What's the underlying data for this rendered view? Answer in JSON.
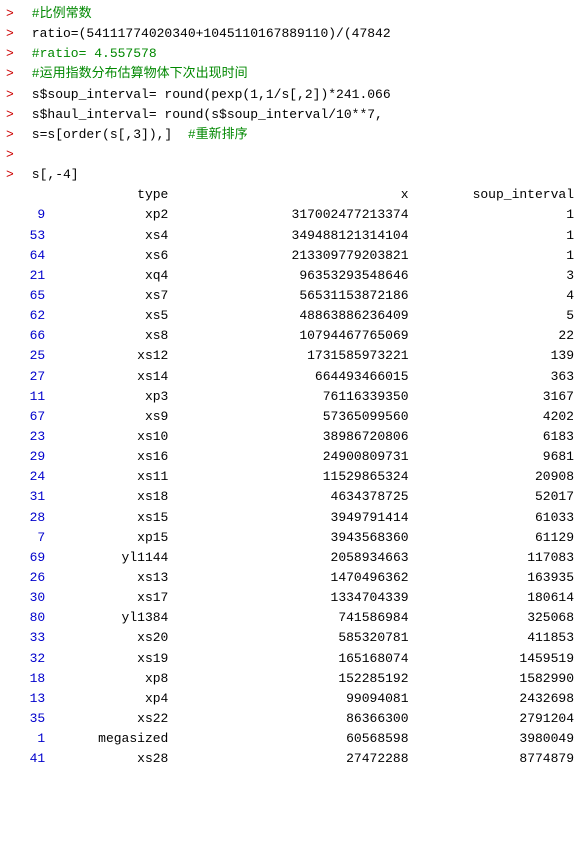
{
  "console": {
    "lines": [
      {
        "id": "line1",
        "prompt": ">",
        "type": "comment",
        "text": " #比例常数"
      },
      {
        "id": "line2",
        "prompt": ">",
        "type": "code",
        "text": " ratio=(54111774020340+1045110167889110)/(47842"
      },
      {
        "id": "line3",
        "prompt": ">",
        "type": "comment",
        "text": " #ratio= 4.557578"
      },
      {
        "id": "line4",
        "prompt": ">",
        "type": "comment",
        "text": " #运用指数分布估算物体下次出现时间"
      },
      {
        "id": "line5",
        "prompt": ">",
        "type": "code",
        "text": " s$soup_interval= round(pexp(1,1/s[,2])*241.066"
      },
      {
        "id": "line6",
        "prompt": ">",
        "type": "code",
        "text": " s$haul_interval= round(s$soup_interval/10**7,"
      },
      {
        "id": "line7",
        "prompt": ">",
        "type": "code",
        "text": " s=s[order(s[,3]),]  #重新排序"
      },
      {
        "id": "line8",
        "prompt": ">",
        "type": "blank",
        "text": ""
      },
      {
        "id": "line9",
        "prompt": ">",
        "type": "code",
        "text": " s[,-4]"
      }
    ],
    "table": {
      "headers": {
        "rownum": "",
        "type": "type",
        "x": "x",
        "soup_interval": "soup_interval"
      },
      "rows": [
        {
          "rownum": "9",
          "type": "xp2",
          "x": "317002477213374",
          "soup": "1"
        },
        {
          "rownum": "53",
          "type": "xs4",
          "x": "349488121314104",
          "soup": "1"
        },
        {
          "rownum": "64",
          "type": "xs6",
          "x": "213309779203821",
          "soup": "1"
        },
        {
          "rownum": "21",
          "type": "xq4",
          "x": "96353293548646",
          "soup": "3"
        },
        {
          "rownum": "65",
          "type": "xs7",
          "x": "56531153872186",
          "soup": "4"
        },
        {
          "rownum": "62",
          "type": "xs5",
          "x": "48863886236409",
          "soup": "5"
        },
        {
          "rownum": "66",
          "type": "xs8",
          "x": "10794467765069",
          "soup": "22"
        },
        {
          "rownum": "25",
          "type": "xs12",
          "x": "1731585973221",
          "soup": "139"
        },
        {
          "rownum": "27",
          "type": "xs14",
          "x": "664493466015",
          "soup": "363"
        },
        {
          "rownum": "11",
          "type": "xp3",
          "x": "76116339350",
          "soup": "3167"
        },
        {
          "rownum": "67",
          "type": "xs9",
          "x": "57365099560",
          "soup": "4202"
        },
        {
          "rownum": "23",
          "type": "xs10",
          "x": "38986720806",
          "soup": "6183"
        },
        {
          "rownum": "29",
          "type": "xs16",
          "x": "24900809731",
          "soup": "9681"
        },
        {
          "rownum": "24",
          "type": "xs11",
          "x": "11529865324",
          "soup": "20908"
        },
        {
          "rownum": "31",
          "type": "xs18",
          "x": "4634378725",
          "soup": "52017"
        },
        {
          "rownum": "28",
          "type": "xs15",
          "x": "3949791414",
          "soup": "61033"
        },
        {
          "rownum": "7",
          "type": "xp15",
          "x": "3943568360",
          "soup": "61129"
        },
        {
          "rownum": "69",
          "type": "yl1144",
          "x": "2058934663",
          "soup": "117083"
        },
        {
          "rownum": "26",
          "type": "xs13",
          "x": "1470496362",
          "soup": "163935"
        },
        {
          "rownum": "30",
          "type": "xs17",
          "x": "1334704339",
          "soup": "180614"
        },
        {
          "rownum": "80",
          "type": "yl1384",
          "x": "741586984",
          "soup": "325068"
        },
        {
          "rownum": "33",
          "type": "xs20",
          "x": "585320781",
          "soup": "411853"
        },
        {
          "rownum": "32",
          "type": "xs19",
          "x": "165168074",
          "soup": "1459519"
        },
        {
          "rownum": "18",
          "type": "xp8",
          "x": "152285192",
          "soup": "1582990"
        },
        {
          "rownum": "13",
          "type": "xp4",
          "x": "99094081",
          "soup": "2432698"
        },
        {
          "rownum": "35",
          "type": "xs22",
          "x": "86366300",
          "soup": "2791204"
        },
        {
          "rownum": "1",
          "type": "megasized",
          "x": "60568598",
          "soup": "3980049"
        },
        {
          "rownum": "41",
          "type": "xs28",
          "x": "27472288",
          "soup": "8774879"
        }
      ]
    }
  }
}
